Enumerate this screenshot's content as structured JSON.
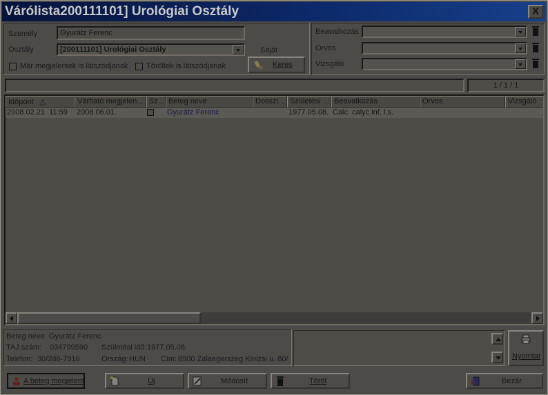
{
  "window": {
    "title": "Várólista200111101] Urológiai Osztály",
    "close_symbol": "X"
  },
  "filters": {
    "person_label": "Személy",
    "person_value": "Gyurátz Ferenc",
    "department_label": "Osztály",
    "department_value": "[200111101] Urológiai Osztály",
    "own_label": "Saját",
    "show_appeared_label": "Már megjelentek is látszódjanak",
    "show_deleted_label": "Töröltek is látszódjanak",
    "search_button": "Keres",
    "intervention_label": "Beavatkozás",
    "doctor_label": "Orvos",
    "examiner_label": "Vizsgáló",
    "intervention_value": "",
    "doctor_value": "",
    "examiner_value": ""
  },
  "status": {
    "progress_text": "",
    "pager": "1 / 1 / 1"
  },
  "table": {
    "headers": [
      "Időpont",
      "Várható megjelen...",
      "Sz...",
      "Beteg neve",
      "Dosszi...",
      "Születési ...",
      "Beavatkozás",
      "Orvos",
      "Vizsgáló"
    ],
    "sort_indicator": "△",
    "rows": [
      {
        "time": "2008.02.21.  11:59",
        "expected": "2008.06.01.",
        "sz": "",
        "patient": "Gyurátz Ferenc",
        "dossier": "",
        "birth": "1977.05.08.",
        "intervention": "Calc. calyc inf. l.s.",
        "doctor": "",
        "examiner": ""
      }
    ]
  },
  "details": {
    "patient_line": "Beteg neve: Gyurátz Ferenc",
    "taj_label": "TAJ szám:",
    "taj_value": "034799590",
    "birth_label": "Születési idő:",
    "birth_value": "1977.05.08.",
    "phone_label": "Telefon:",
    "phone_value": "30/286-7916",
    "country_label": "Ország:",
    "country_value": "HUN",
    "address_label": "Cím:",
    "address_value": "8900 Zalaegerszeg Kinizsi u. 80/",
    "print_button": "Nyomtat"
  },
  "actions": {
    "appeared": "A beteg megjelent",
    "new": "Új",
    "modify": "Módosít",
    "delete": "Töröl",
    "close": "Bezár"
  }
}
